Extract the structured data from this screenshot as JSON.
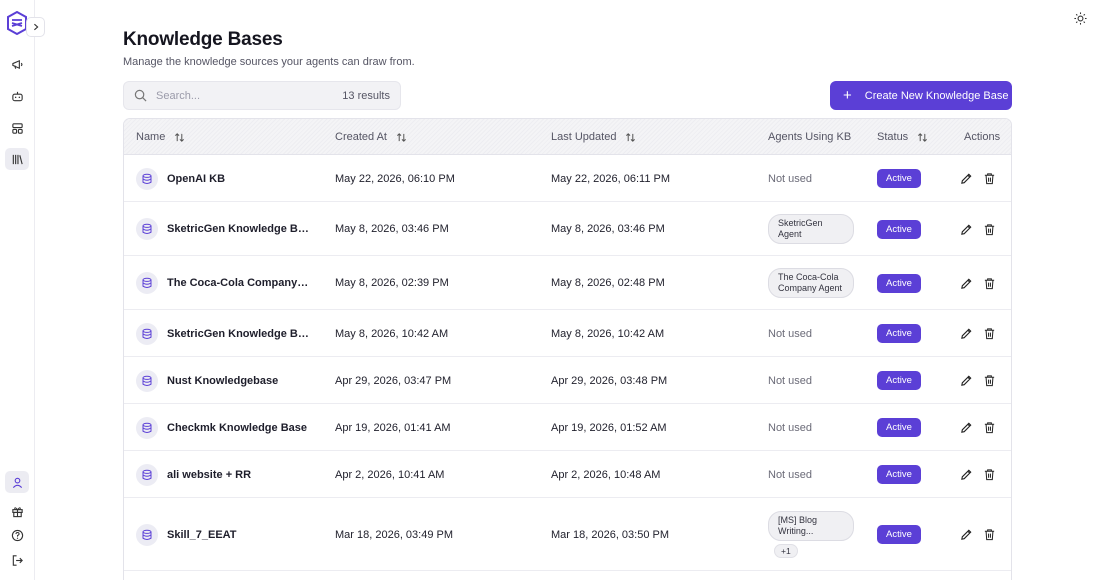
{
  "header": {
    "title": "Knowledge Bases",
    "subtitle": "Manage the knowledge sources your agents can draw from."
  },
  "search": {
    "placeholder": "Search...",
    "value": "",
    "result_count": "13 results"
  },
  "create_button": {
    "label": "Create New Knowledge Base",
    "icon": "plus-icon"
  },
  "table": {
    "columns": [
      {
        "label": "Name",
        "sortable": true
      },
      {
        "label": "Created At",
        "sortable": true
      },
      {
        "label": "Last Updated",
        "sortable": true
      },
      {
        "label": "Agents Using KB",
        "sortable": false
      },
      {
        "label": "Status",
        "sortable": true
      },
      {
        "label": "Actions",
        "sortable": false
      }
    ],
    "rows": [
      {
        "name": "OpenAI KB",
        "created": "May 22, 2026, 06:10 PM",
        "updated": "May 22, 2026, 06:11 PM",
        "agents": "Not used",
        "agents_chip": false,
        "extra": "",
        "status": "Active"
      },
      {
        "name": "SketricGen Knowledge Base",
        "created": "May 8, 2026, 03:46 PM",
        "updated": "May 8, 2026, 03:46 PM",
        "agents": "SketricGen Agent",
        "agents_chip": true,
        "extra": "",
        "status": "Active"
      },
      {
        "name": "The Coca-Cola Company Kn...",
        "created": "May 8, 2026, 02:39 PM",
        "updated": "May 8, 2026, 02:48 PM",
        "agents": "The Coca-Cola Company Agent",
        "agents_chip": true,
        "extra": "",
        "status": "Active"
      },
      {
        "name": "SketricGen Knowledge Base",
        "created": "May 8, 2026, 10:42 AM",
        "updated": "May 8, 2026, 10:42 AM",
        "agents": "Not used",
        "agents_chip": false,
        "extra": "",
        "status": "Active"
      },
      {
        "name": "Nust Knowledgebase",
        "created": "Apr 29, 2026, 03:47 PM",
        "updated": "Apr 29, 2026, 03:48 PM",
        "agents": "Not used",
        "agents_chip": false,
        "extra": "",
        "status": "Active"
      },
      {
        "name": "Checkmk Knowledge Base",
        "created": "Apr 19, 2026, 01:41 AM",
        "updated": "Apr 19, 2026, 01:52 AM",
        "agents": "Not used",
        "agents_chip": false,
        "extra": "",
        "status": "Active"
      },
      {
        "name": "ali website + RR",
        "created": "Apr 2, 2026, 10:41 AM",
        "updated": "Apr 2, 2026, 10:48 AM",
        "agents": "Not used",
        "agents_chip": false,
        "extra": "",
        "status": "Active"
      },
      {
        "name": "Skill_7_EEAT",
        "created": "Mar 18, 2026, 03:49 PM",
        "updated": "Mar 18, 2026, 03:50 PM",
        "agents": "[MS] Blog Writing...",
        "agents_chip": true,
        "extra": "+1",
        "status": "Active"
      }
    ]
  },
  "sidebar": {
    "top_items": [
      {
        "icon": "megaphone-icon",
        "active": false
      },
      {
        "icon": "bot-icon",
        "active": false
      },
      {
        "icon": "layout-icon",
        "active": false
      },
      {
        "icon": "library-icon",
        "active": true
      }
    ],
    "bottom_items": [
      {
        "icon": "user-icon",
        "active": true
      },
      {
        "icon": "gift-icon",
        "active": false
      },
      {
        "icon": "help-icon",
        "active": false
      },
      {
        "icon": "logout-icon",
        "active": false
      }
    ]
  },
  "colors": {
    "accent": "#5b3fd6",
    "badge_text": "#ffffff"
  }
}
